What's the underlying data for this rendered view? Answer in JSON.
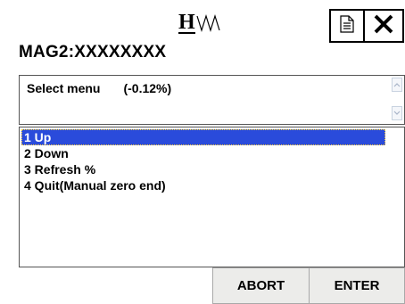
{
  "header": {
    "logo_icon": "hart-logo-icon",
    "doc_icon": "document-icon",
    "close_icon": "close-icon"
  },
  "device": {
    "title": "MAG2:XXXXXXXX"
  },
  "prompt": {
    "label": "Select menu",
    "value": "(-0.12%)",
    "scroll_up_icon": "scroll-up-arrow-icon",
    "scroll_down_icon": "scroll-down-arrow-icon"
  },
  "menu": {
    "items": [
      {
        "label": "1 Up",
        "selected": true
      },
      {
        "label": "2 Down",
        "selected": false
      },
      {
        "label": "3 Refresh %",
        "selected": false
      },
      {
        "label": "4 Quit(Manual zero end)",
        "selected": false
      }
    ]
  },
  "buttons": {
    "abort_label": "ABORT",
    "enter_label": "ENTER"
  },
  "colors": {
    "selection": "#2a4bdb",
    "button_face": "#ececea"
  }
}
